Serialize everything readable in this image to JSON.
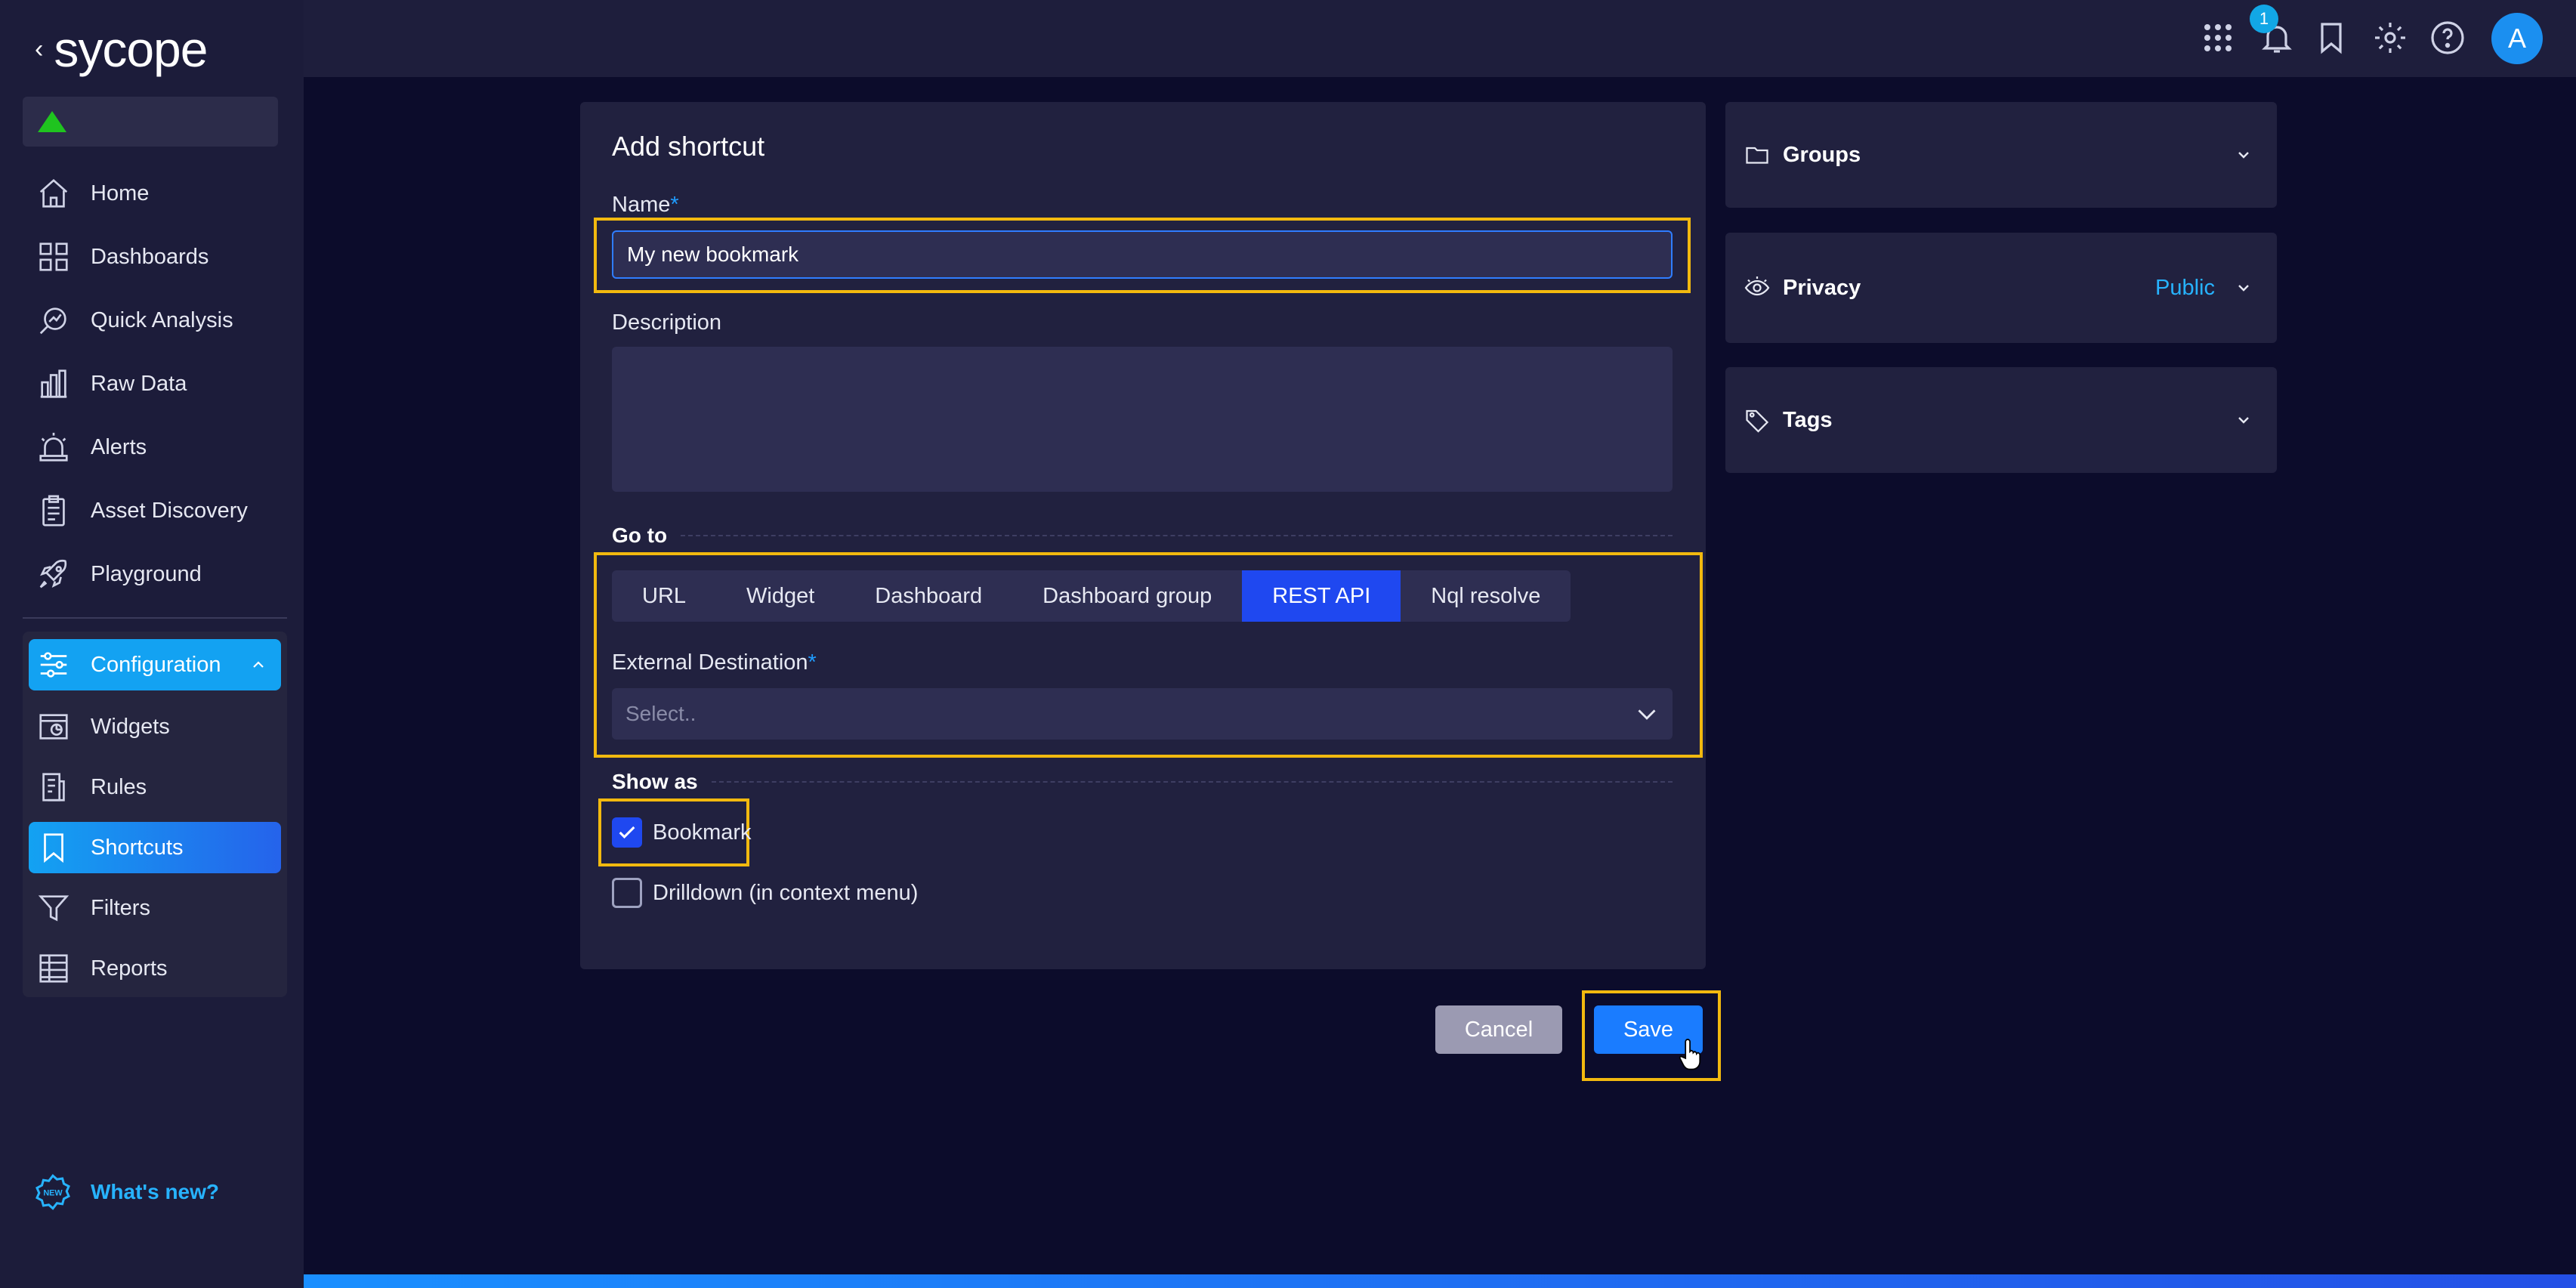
{
  "brand": {
    "logo_text": "sycope",
    "back_glyph": "‹"
  },
  "sidebar": {
    "items": [
      {
        "label": "Home",
        "icon": "home-icon"
      },
      {
        "label": "Dashboards",
        "icon": "dashboards-icon"
      },
      {
        "label": "Quick Analysis",
        "icon": "quick-analysis-icon"
      },
      {
        "label": "Raw Data",
        "icon": "raw-data-icon"
      },
      {
        "label": "Alerts",
        "icon": "alerts-icon"
      },
      {
        "label": "Asset Discovery",
        "icon": "asset-discovery-icon"
      },
      {
        "label": "Playground",
        "icon": "playground-icon"
      }
    ],
    "config": {
      "label": "Configuration",
      "items": [
        {
          "label": "Widgets"
        },
        {
          "label": "Rules"
        },
        {
          "label": "Shortcuts",
          "active": true
        },
        {
          "label": "Filters"
        },
        {
          "label": "Reports"
        }
      ]
    },
    "whats_new": "What's new?"
  },
  "topbar": {
    "notification_count": "1",
    "avatar_letter": "A"
  },
  "form": {
    "title": "Add shortcut",
    "name_label": "Name",
    "required_mark": "*",
    "name_value": "My new bookmark",
    "description_label": "Description",
    "goto_label": "Go to",
    "tabs": [
      "URL",
      "Widget",
      "Dashboard",
      "Dashboard group",
      "REST API",
      "Nql resolve"
    ],
    "active_tab": "REST API",
    "external_label": "External Destination",
    "external_placeholder": "Select..",
    "show_as_label": "Show as",
    "bookmark_label": "Bookmark",
    "bookmark_checked": true,
    "drilldown_label": "Drilldown (in context menu)",
    "drilldown_checked": false
  },
  "buttons": {
    "cancel": "Cancel",
    "save": "Save"
  },
  "panels": {
    "groups": {
      "label": "Groups"
    },
    "privacy": {
      "label": "Privacy",
      "value": "Public"
    },
    "tags": {
      "label": "Tags"
    }
  },
  "colors": {
    "accent": "#1a7cff",
    "active_tab": "#1f48f0",
    "highlight": "#f2b90f",
    "status_ok": "#1fc41f"
  }
}
